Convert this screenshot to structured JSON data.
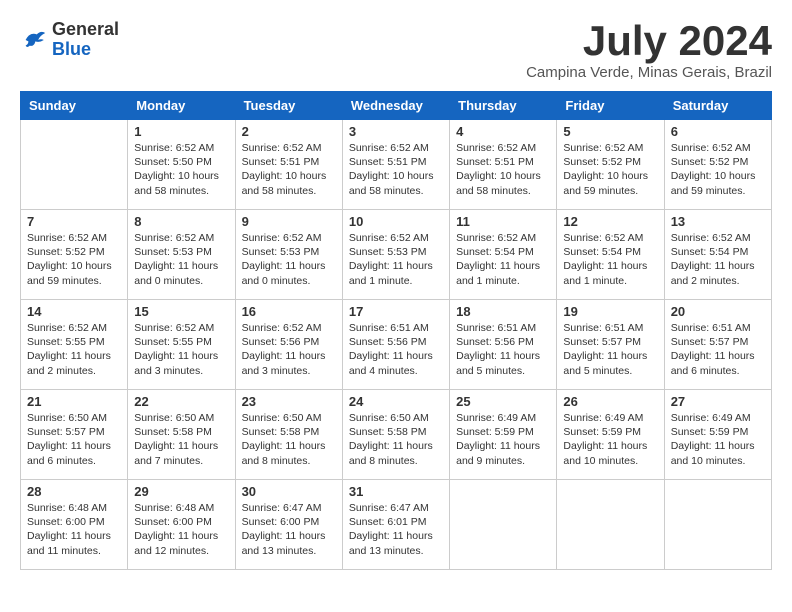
{
  "header": {
    "logo_general": "General",
    "logo_blue": "Blue",
    "month_title": "July 2024",
    "location": "Campina Verde, Minas Gerais, Brazil"
  },
  "days_of_week": [
    "Sunday",
    "Monday",
    "Tuesday",
    "Wednesday",
    "Thursday",
    "Friday",
    "Saturday"
  ],
  "weeks": [
    [
      {
        "day": "",
        "info": ""
      },
      {
        "day": "1",
        "info": "Sunrise: 6:52 AM\nSunset: 5:50 PM\nDaylight: 10 hours\nand 58 minutes."
      },
      {
        "day": "2",
        "info": "Sunrise: 6:52 AM\nSunset: 5:51 PM\nDaylight: 10 hours\nand 58 minutes."
      },
      {
        "day": "3",
        "info": "Sunrise: 6:52 AM\nSunset: 5:51 PM\nDaylight: 10 hours\nand 58 minutes."
      },
      {
        "day": "4",
        "info": "Sunrise: 6:52 AM\nSunset: 5:51 PM\nDaylight: 10 hours\nand 58 minutes."
      },
      {
        "day": "5",
        "info": "Sunrise: 6:52 AM\nSunset: 5:52 PM\nDaylight: 10 hours\nand 59 minutes."
      },
      {
        "day": "6",
        "info": "Sunrise: 6:52 AM\nSunset: 5:52 PM\nDaylight: 10 hours\nand 59 minutes."
      }
    ],
    [
      {
        "day": "7",
        "info": "Sunrise: 6:52 AM\nSunset: 5:52 PM\nDaylight: 10 hours\nand 59 minutes."
      },
      {
        "day": "8",
        "info": "Sunrise: 6:52 AM\nSunset: 5:53 PM\nDaylight: 11 hours\nand 0 minutes."
      },
      {
        "day": "9",
        "info": "Sunrise: 6:52 AM\nSunset: 5:53 PM\nDaylight: 11 hours\nand 0 minutes."
      },
      {
        "day": "10",
        "info": "Sunrise: 6:52 AM\nSunset: 5:53 PM\nDaylight: 11 hours\nand 1 minute."
      },
      {
        "day": "11",
        "info": "Sunrise: 6:52 AM\nSunset: 5:54 PM\nDaylight: 11 hours\nand 1 minute."
      },
      {
        "day": "12",
        "info": "Sunrise: 6:52 AM\nSunset: 5:54 PM\nDaylight: 11 hours\nand 1 minute."
      },
      {
        "day": "13",
        "info": "Sunrise: 6:52 AM\nSunset: 5:54 PM\nDaylight: 11 hours\nand 2 minutes."
      }
    ],
    [
      {
        "day": "14",
        "info": "Sunrise: 6:52 AM\nSunset: 5:55 PM\nDaylight: 11 hours\nand 2 minutes."
      },
      {
        "day": "15",
        "info": "Sunrise: 6:52 AM\nSunset: 5:55 PM\nDaylight: 11 hours\nand 3 minutes."
      },
      {
        "day": "16",
        "info": "Sunrise: 6:52 AM\nSunset: 5:56 PM\nDaylight: 11 hours\nand 3 minutes."
      },
      {
        "day": "17",
        "info": "Sunrise: 6:51 AM\nSunset: 5:56 PM\nDaylight: 11 hours\nand 4 minutes."
      },
      {
        "day": "18",
        "info": "Sunrise: 6:51 AM\nSunset: 5:56 PM\nDaylight: 11 hours\nand 5 minutes."
      },
      {
        "day": "19",
        "info": "Sunrise: 6:51 AM\nSunset: 5:57 PM\nDaylight: 11 hours\nand 5 minutes."
      },
      {
        "day": "20",
        "info": "Sunrise: 6:51 AM\nSunset: 5:57 PM\nDaylight: 11 hours\nand 6 minutes."
      }
    ],
    [
      {
        "day": "21",
        "info": "Sunrise: 6:50 AM\nSunset: 5:57 PM\nDaylight: 11 hours\nand 6 minutes."
      },
      {
        "day": "22",
        "info": "Sunrise: 6:50 AM\nSunset: 5:58 PM\nDaylight: 11 hours\nand 7 minutes."
      },
      {
        "day": "23",
        "info": "Sunrise: 6:50 AM\nSunset: 5:58 PM\nDaylight: 11 hours\nand 8 minutes."
      },
      {
        "day": "24",
        "info": "Sunrise: 6:50 AM\nSunset: 5:58 PM\nDaylight: 11 hours\nand 8 minutes."
      },
      {
        "day": "25",
        "info": "Sunrise: 6:49 AM\nSunset: 5:59 PM\nDaylight: 11 hours\nand 9 minutes."
      },
      {
        "day": "26",
        "info": "Sunrise: 6:49 AM\nSunset: 5:59 PM\nDaylight: 11 hours\nand 10 minutes."
      },
      {
        "day": "27",
        "info": "Sunrise: 6:49 AM\nSunset: 5:59 PM\nDaylight: 11 hours\nand 10 minutes."
      }
    ],
    [
      {
        "day": "28",
        "info": "Sunrise: 6:48 AM\nSunset: 6:00 PM\nDaylight: 11 hours\nand 11 minutes."
      },
      {
        "day": "29",
        "info": "Sunrise: 6:48 AM\nSunset: 6:00 PM\nDaylight: 11 hours\nand 12 minutes."
      },
      {
        "day": "30",
        "info": "Sunrise: 6:47 AM\nSunset: 6:00 PM\nDaylight: 11 hours\nand 13 minutes."
      },
      {
        "day": "31",
        "info": "Sunrise: 6:47 AM\nSunset: 6:01 PM\nDaylight: 11 hours\nand 13 minutes."
      },
      {
        "day": "",
        "info": ""
      },
      {
        "day": "",
        "info": ""
      },
      {
        "day": "",
        "info": ""
      }
    ]
  ]
}
